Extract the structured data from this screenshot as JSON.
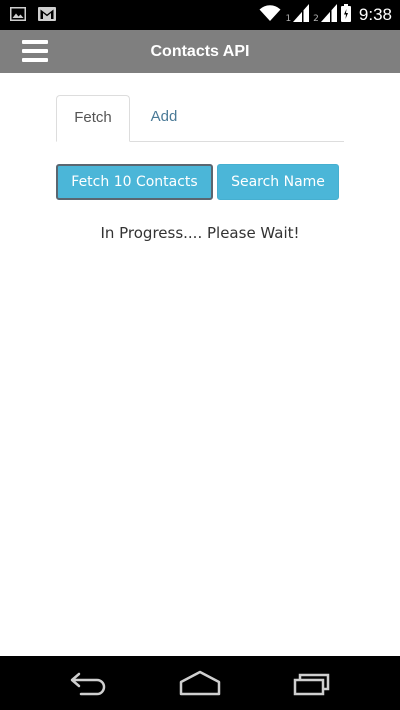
{
  "status_bar": {
    "sim1_label": "1",
    "sim2_label": "2",
    "time": "9:38",
    "left_icons": [
      "image-icon",
      "gmail-icon"
    ],
    "right_icons": [
      "wifi-icon",
      "signal-sim1-icon",
      "signal-sim2-icon",
      "battery-icon"
    ]
  },
  "app_bar": {
    "title": "Contacts API",
    "menu_icon": "hamburger-menu-icon",
    "background": "#7f7f7f"
  },
  "tabs": [
    {
      "label": "Fetch",
      "active": true
    },
    {
      "label": "Add",
      "active": false
    }
  ],
  "buttons": {
    "fetch_label": "Fetch 10 Contacts",
    "search_label": "Search Name",
    "color": "#4bb6d8"
  },
  "status_message": "In Progress.... Please Wait!",
  "nav_bar": {
    "icons": [
      "back-icon",
      "home-icon",
      "recent-apps-icon"
    ]
  }
}
